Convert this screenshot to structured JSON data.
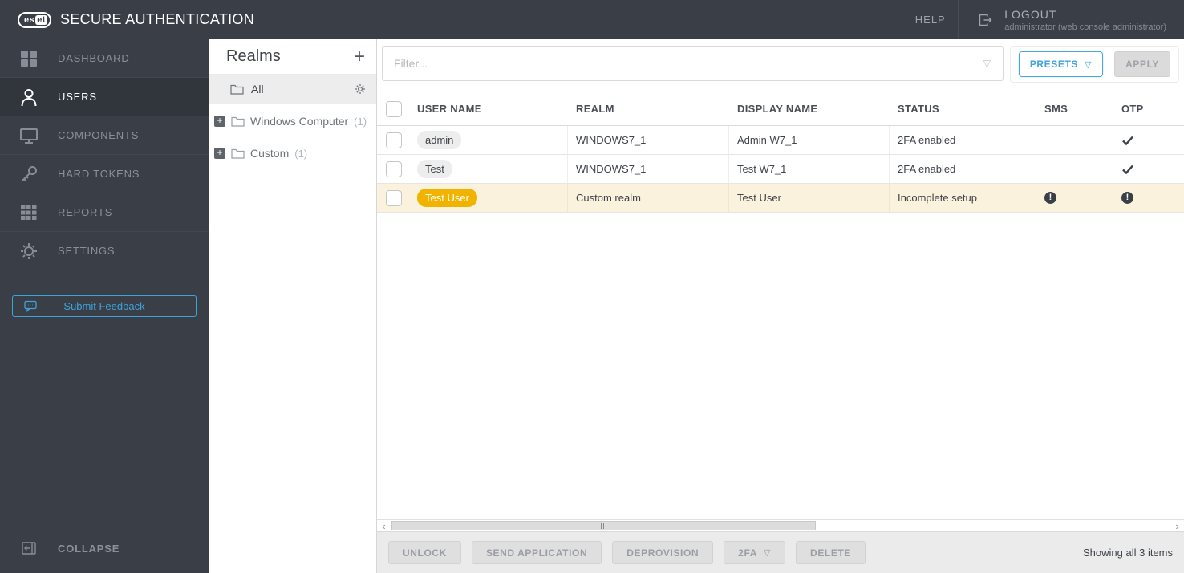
{
  "colors": {
    "topbar_bg": "#3A3F47",
    "accent_blue": "#3DA3DC",
    "badge_amber": "#F0B400",
    "row_highlight": "#FAF2DD",
    "badge_gray": "#EDEDED",
    "warning_dark": "#3A3F47"
  },
  "icons": {
    "triangle_down": "▽",
    "plus": "+",
    "chevron_left": "‹",
    "chevron_right": "›",
    "warning_glyph": "!"
  },
  "topbar": {
    "logo_es": "es",
    "logo_et": "et",
    "brand": "SECURE AUTHENTICATION",
    "help": "HELP",
    "logout": "LOGOUT",
    "logout_sub": "administrator (web console administrator)"
  },
  "sidebar": {
    "items": [
      {
        "label": "DASHBOARD",
        "active": false
      },
      {
        "label": "USERS",
        "active": true
      },
      {
        "label": "COMPONENTS",
        "active": false
      },
      {
        "label": "HARD TOKENS",
        "active": false
      },
      {
        "label": "REPORTS",
        "active": false
      },
      {
        "label": "SETTINGS",
        "active": false
      }
    ],
    "feedback": "Submit Feedback",
    "collapse": "COLLAPSE"
  },
  "realms": {
    "title": "Realms",
    "all": {
      "label": "All",
      "selected": true
    },
    "items": [
      {
        "label": "Windows Computer",
        "count": "(1)"
      },
      {
        "label": "Custom",
        "count": "(1)"
      }
    ]
  },
  "filter": {
    "placeholder": "Filter...",
    "presets_label": "PRESETS",
    "apply_label": "APPLY"
  },
  "table": {
    "columns": [
      "USER NAME",
      "REALM",
      "DISPLAY NAME",
      "STATUS",
      "SMS",
      "OTP"
    ],
    "rows": [
      {
        "username": "admin",
        "realm": "WINDOWS7_1",
        "display": "Admin W7_1",
        "status": "2FA enabled",
        "sms": "",
        "otp": "check",
        "highlighted": false
      },
      {
        "username": "Test",
        "realm": "WINDOWS7_1",
        "display": "Test W7_1",
        "status": "2FA enabled",
        "sms": "",
        "otp": "check",
        "highlighted": false
      },
      {
        "username": "Test User",
        "realm": "Custom realm",
        "display": "Test User",
        "status": "Incomplete setup",
        "sms": "warning",
        "otp": "warning",
        "highlighted": true
      }
    ]
  },
  "footer": {
    "buttons": [
      "UNLOCK",
      "SEND APPLICATION",
      "DEPROVISION",
      "2FA",
      "DELETE"
    ],
    "showing": "Showing all 3 items"
  }
}
